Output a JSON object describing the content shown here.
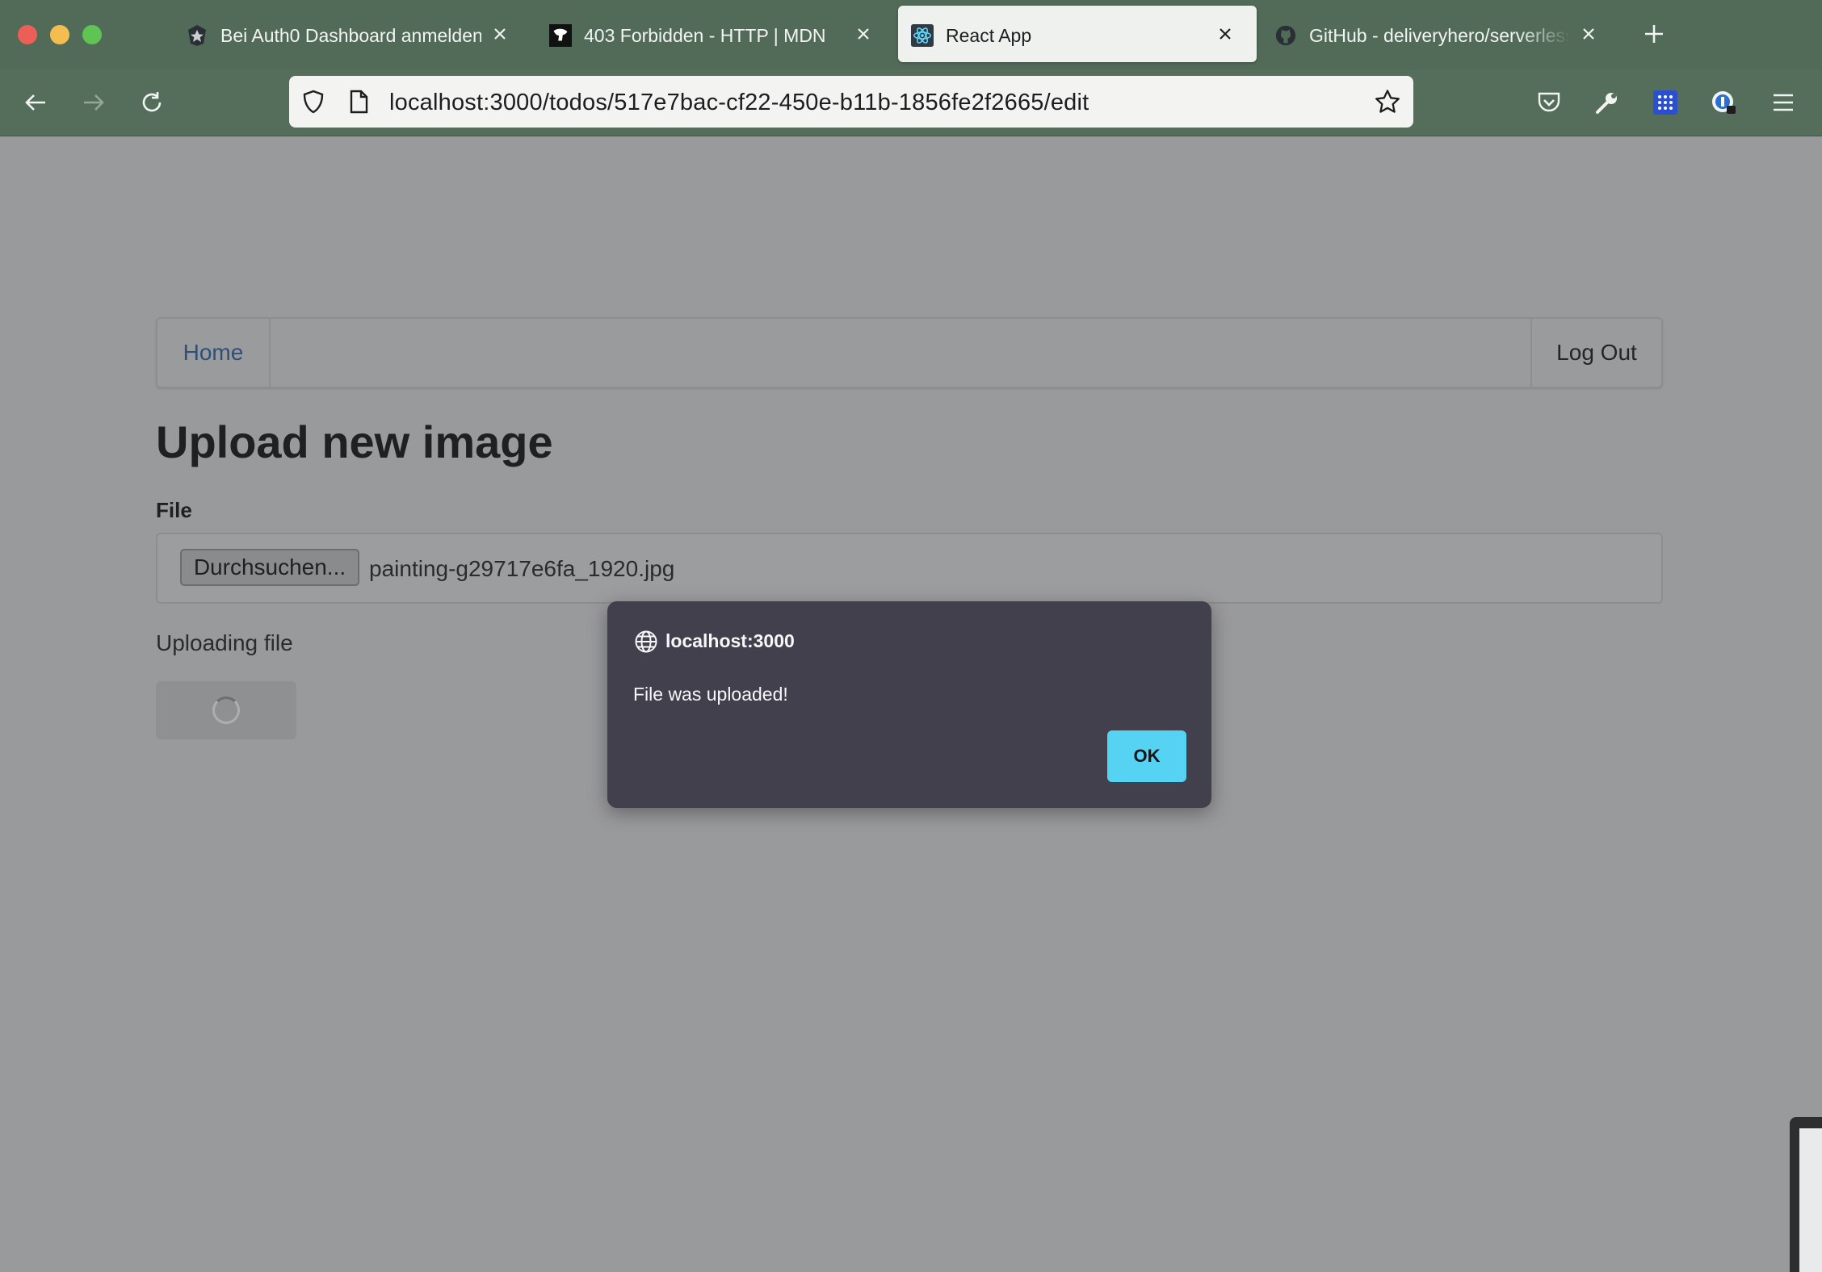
{
  "browser": {
    "tabs": [
      {
        "title": "Bei Auth0 Dashboard anmelden",
        "favicon": "auth0-icon",
        "active": false
      },
      {
        "title": "403 Forbidden - HTTP | MDN",
        "favicon": "mdn-icon",
        "active": false
      },
      {
        "title": "React App",
        "favicon": "react-icon",
        "active": true
      },
      {
        "title": "GitHub - deliveryhero/serverless",
        "favicon": "github-icon",
        "active": false
      }
    ],
    "url": {
      "host": "localhost:3000",
      "path": "/todos/517e7bac-cf22-450e-b11b-1856fe2f2665/edit"
    }
  },
  "app": {
    "menu": {
      "home": "Home",
      "logout": "Log Out"
    },
    "heading": "Upload new image",
    "file_label": "File",
    "browse_button": "Durchsuchen...",
    "file_name": "painting-g29717e6fa_1920.jpg",
    "status": "Uploading file"
  },
  "dialog": {
    "origin": "localhost:3000",
    "message": "File was uploaded!",
    "ok_label": "OK"
  },
  "colors": {
    "chrome": "#516b58",
    "page_overlay": "#999a9c",
    "dialog_bg": "#42404c",
    "ok_button": "#56d2f2",
    "link": "#2f4f78"
  }
}
